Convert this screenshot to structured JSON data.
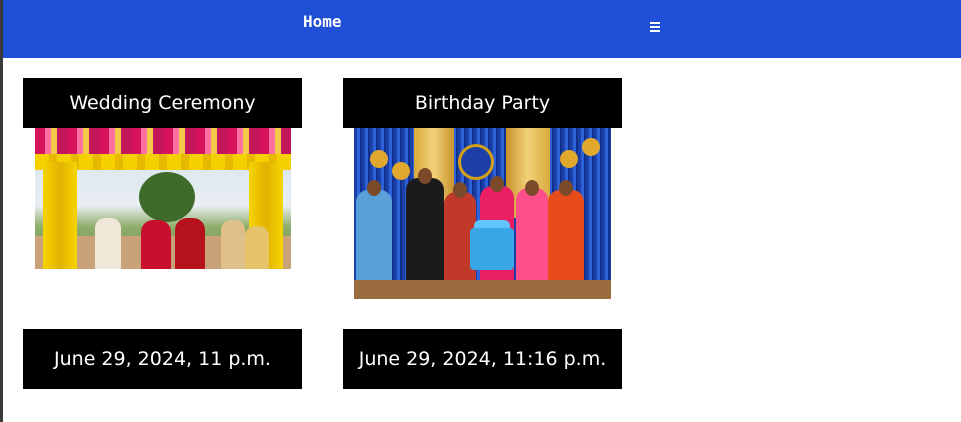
{
  "nav": {
    "home_label": "Home",
    "menu_icon": "hamburger-menu-icon",
    "background_color": "#1e4fd6"
  },
  "events": [
    {
      "title": "Wedding Ceremony",
      "date": "June 29, 2024, 11 p.m."
    },
    {
      "title": "Birthday Party",
      "date": "June 29, 2024, 11:16 p.m."
    }
  ]
}
